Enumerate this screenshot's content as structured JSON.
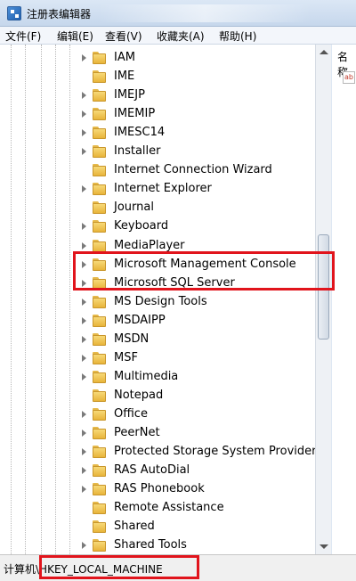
{
  "window": {
    "title": "注册表编辑器"
  },
  "menu": [
    "文件(F)",
    "编辑(E)",
    "查看(V)",
    "收藏夹(A)",
    "帮助(H)"
  ],
  "tree": {
    "items": [
      {
        "label": "IAM",
        "expandable": true
      },
      {
        "label": "IME",
        "expandable": false
      },
      {
        "label": "IMEJP",
        "expandable": true
      },
      {
        "label": "IMEMIP",
        "expandable": true
      },
      {
        "label": "IMESC14",
        "expandable": true
      },
      {
        "label": "Installer",
        "expandable": true
      },
      {
        "label": "Internet Connection Wizard",
        "expandable": false
      },
      {
        "label": "Internet Explorer",
        "expandable": true
      },
      {
        "label": "Journal",
        "expandable": false
      },
      {
        "label": "Keyboard",
        "expandable": true
      },
      {
        "label": "MediaPlayer",
        "expandable": true
      },
      {
        "label": "Microsoft Management Console",
        "expandable": true
      },
      {
        "label": "Microsoft SQL Server",
        "expandable": true
      },
      {
        "label": "MS Design Tools",
        "expandable": true
      },
      {
        "label": "MSDAIPP",
        "expandable": true
      },
      {
        "label": "MSDN",
        "expandable": true
      },
      {
        "label": "MSF",
        "expandable": true
      },
      {
        "label": "Multimedia",
        "expandable": true
      },
      {
        "label": "Notepad",
        "expandable": false
      },
      {
        "label": "Office",
        "expandable": true
      },
      {
        "label": "PeerNet",
        "expandable": true
      },
      {
        "label": "Protected Storage System Provider",
        "expandable": true
      },
      {
        "label": "RAS AutoDial",
        "expandable": true
      },
      {
        "label": "RAS Phonebook",
        "expandable": true
      },
      {
        "label": "Remote Assistance",
        "expandable": false
      },
      {
        "label": "Shared",
        "expandable": false
      },
      {
        "label": "Shared Tools",
        "expandable": true
      }
    ]
  },
  "right_pane": {
    "column_header": "名称",
    "value_icon": "ab"
  },
  "statusbar": {
    "prefix": "计算机",
    "path": "\\HKEY_LOCAL_MACHINE"
  },
  "colors": {
    "highlight": "#e1141c",
    "folder": "#f2c94c"
  }
}
